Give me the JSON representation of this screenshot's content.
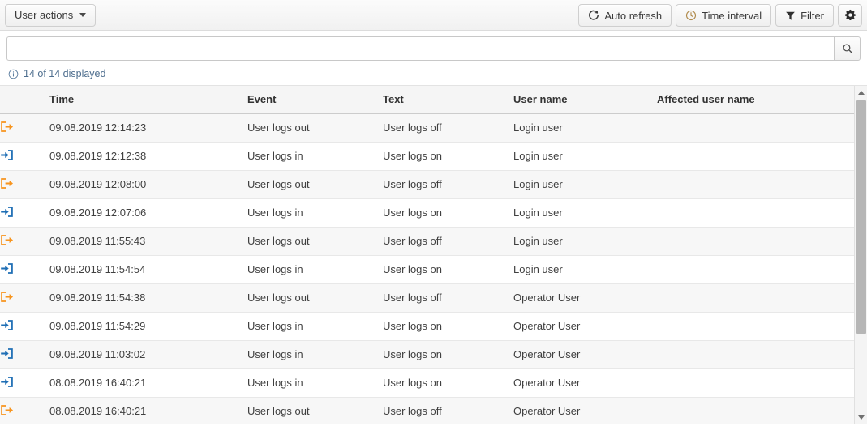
{
  "toolbar": {
    "user_actions_label": "User actions",
    "auto_refresh_label": "Auto refresh",
    "time_interval_label": "Time interval",
    "filter_label": "Filter",
    "settings_icon": "gear-icon",
    "refresh_icon": "refresh-icon",
    "clock_icon": "clock-icon",
    "funnel_icon": "funnel-icon"
  },
  "search": {
    "value": "",
    "placeholder": "",
    "button_icon": "search-icon"
  },
  "status": {
    "info_icon": "info-circle-icon",
    "text": "14 of 14 displayed"
  },
  "table": {
    "columns": [
      {
        "key": "icon",
        "label": ""
      },
      {
        "key": "time",
        "label": "Time"
      },
      {
        "key": "event",
        "label": "Event"
      },
      {
        "key": "text",
        "label": "Text"
      },
      {
        "key": "user",
        "label": "User name"
      },
      {
        "key": "aff",
        "label": "Affected user name"
      }
    ],
    "rows": [
      {
        "icon": "logout-icon",
        "time": "09.08.2019 12:14:23",
        "event": "User logs out",
        "text": "User logs off",
        "user": "Login user",
        "aff": ""
      },
      {
        "icon": "login-icon",
        "time": "09.08.2019 12:12:38",
        "event": "User logs in",
        "text": "User logs on",
        "user": "Login user",
        "aff": ""
      },
      {
        "icon": "logout-icon",
        "time": "09.08.2019 12:08:00",
        "event": "User logs out",
        "text": "User logs off",
        "user": "Login user",
        "aff": ""
      },
      {
        "icon": "login-icon",
        "time": "09.08.2019 12:07:06",
        "event": "User logs in",
        "text": "User logs on",
        "user": "Login user",
        "aff": ""
      },
      {
        "icon": "logout-icon",
        "time": "09.08.2019 11:55:43",
        "event": "User logs out",
        "text": "User logs off",
        "user": "Login user",
        "aff": ""
      },
      {
        "icon": "login-icon",
        "time": "09.08.2019 11:54:54",
        "event": "User logs in",
        "text": "User logs on",
        "user": "Login user",
        "aff": ""
      },
      {
        "icon": "logout-icon",
        "time": "09.08.2019 11:54:38",
        "event": "User logs out",
        "text": "User logs off",
        "user": "Operator User",
        "aff": ""
      },
      {
        "icon": "login-icon",
        "time": "09.08.2019 11:54:29",
        "event": "User logs in",
        "text": "User logs on",
        "user": "Operator User",
        "aff": ""
      },
      {
        "icon": "login-icon",
        "time": "09.08.2019 11:03:02",
        "event": "User logs in",
        "text": "User logs on",
        "user": "Operator User",
        "aff": ""
      },
      {
        "icon": "login-icon",
        "time": "08.08.2019 16:40:21",
        "event": "User logs in",
        "text": "User logs on",
        "user": "Operator User",
        "aff": ""
      },
      {
        "icon": "logout-icon",
        "time": "08.08.2019 16:40:21",
        "event": "User logs out",
        "text": "User logs off",
        "user": "Operator User",
        "aff": ""
      }
    ]
  },
  "scrollbar": {
    "up_icon": "scroll-up-arrow-icon",
    "down_icon": "scroll-down-arrow-icon"
  },
  "colors": {
    "logout_orange": "#f7941e",
    "login_blue": "#1f6fb5",
    "link_blue": "#4e6e8e"
  }
}
